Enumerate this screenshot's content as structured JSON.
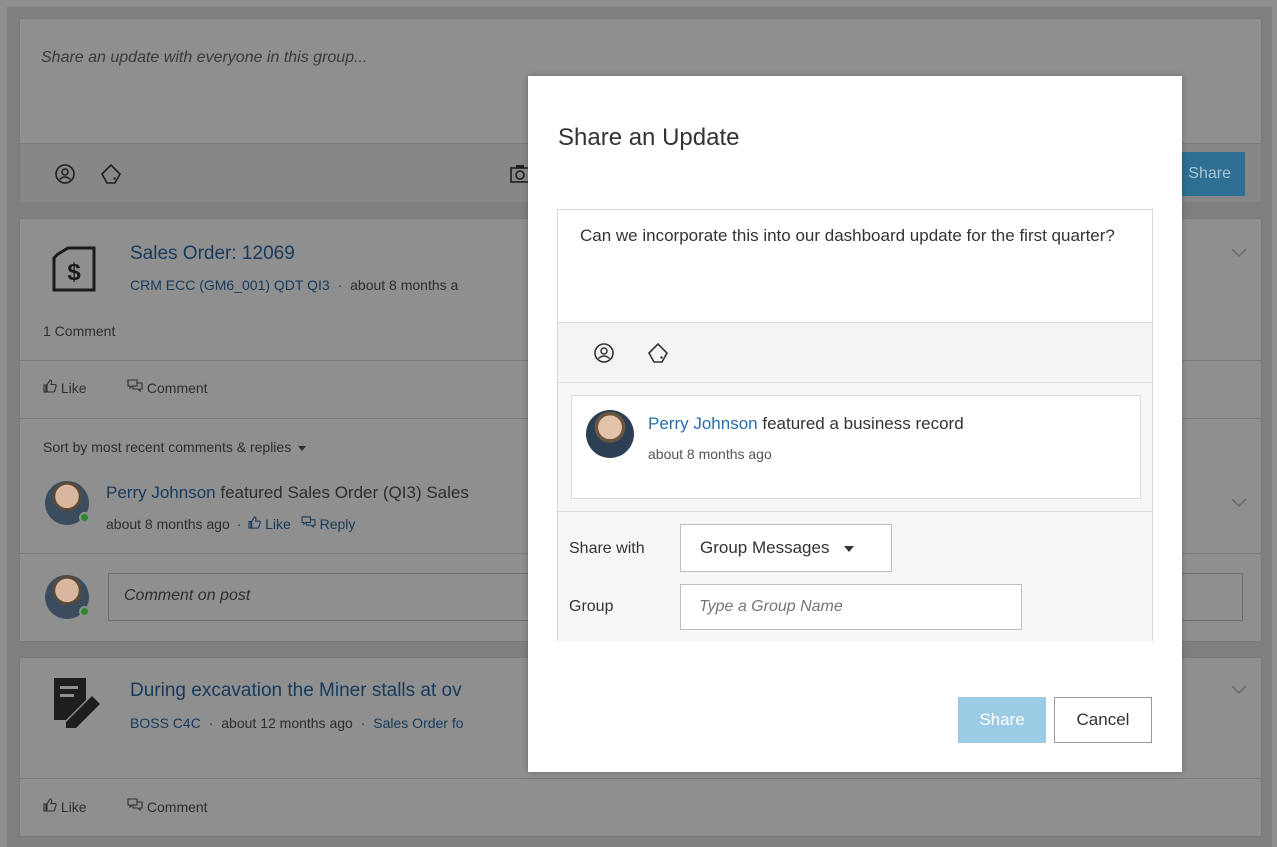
{
  "composer": {
    "placeholder": "Share an update with everyone in this group...",
    "share_label": "Share"
  },
  "post1": {
    "title": "Sales Order: 12069",
    "source": "CRM ECC (GM6_001) QDT QI3",
    "separator": "·",
    "time": "about 8 months a",
    "comment_count": "1 Comment",
    "like_label": "Like",
    "comment_label": "Comment",
    "sort_label": "Sort by most recent comments & replies",
    "reply": {
      "author": "Perry Johnson",
      "text": "featured Sales Order (QI3) Sales",
      "time": "about 8 months ago",
      "like_label": "Like",
      "reply_label": "Reply"
    },
    "comment_placeholder": "Comment on post"
  },
  "post2": {
    "title": "During excavation the Miner stalls at ov",
    "source": "BOSS C4C",
    "time": "about 12 months ago",
    "link": "Sales Order fo",
    "like_label": "Like",
    "comment_label": "Comment"
  },
  "modal": {
    "title": "Share an Update",
    "message": "Can we incorporate this into our dashboard update for the first quarter?",
    "record": {
      "author": "Perry Johnson",
      "action": "featured a business record",
      "time": "about 8 months ago"
    },
    "share_with_label": "Share with",
    "share_with_value": "Group Messages",
    "group_label": "Group",
    "group_placeholder": "Type a Group Name",
    "share_button": "Share",
    "cancel_button": "Cancel"
  },
  "colors": {
    "link": "#2a6ea8",
    "share_button_disabled": "#9ccbe6",
    "overlay": "#8f8f8f"
  }
}
